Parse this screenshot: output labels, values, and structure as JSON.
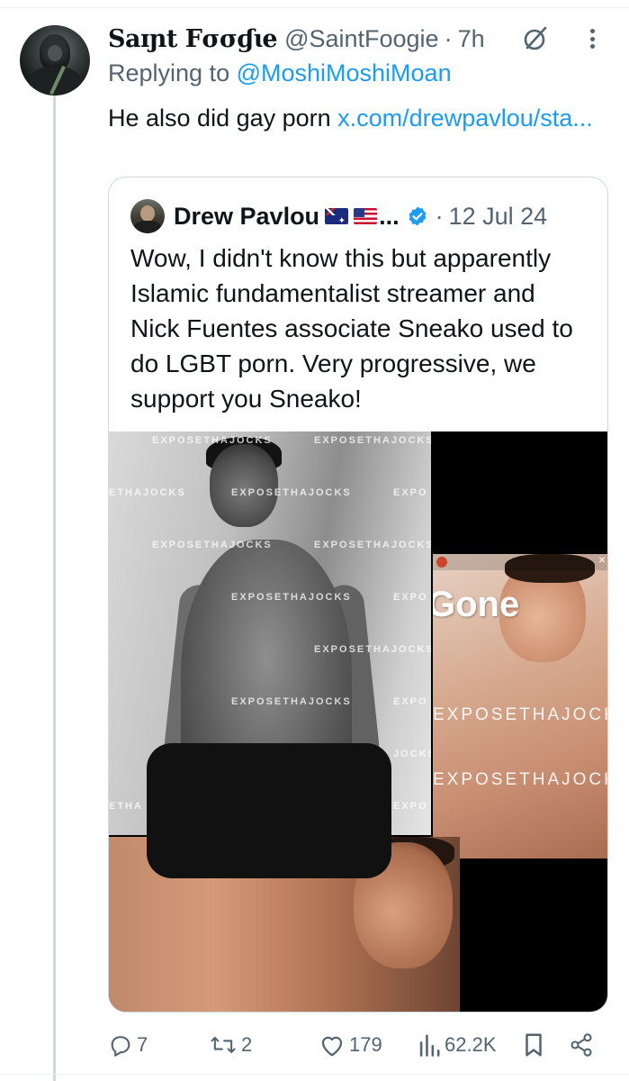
{
  "tweet": {
    "display_name": "Saɪɲt Fσσɠɩe",
    "handle": "@SaintFoogie",
    "separator": "·",
    "time": "7h",
    "replying_prefix": "Replying to ",
    "replying_to": "@MoshiMoshiMoan",
    "text": "He also did gay porn ",
    "link": "x.com/drewpavlou/sta..."
  },
  "quote": {
    "display_name": "Drew Pavlou",
    "ellipsis": "...",
    "separator": "·",
    "date": "12 Jul 24",
    "text": "Wow, I didn't know this but apparently Islamic fundamentalist streamer and Nick Fuentes associate Sneako used to do LGBT porn.  Very progressive, we support you Sneako!",
    "media": {
      "watermark": "EXPOSETHAJOCKS",
      "watermark_partial_1": "ETHAJOCKS",
      "watermark_partial_2": "EXPO",
      "watermark_partial_3": "JOCKS",
      "watermark_partial_4": "ETHA",
      "story_watermark": "EXPOSETHAJOCK",
      "story_caption": "Gone"
    }
  },
  "actions": {
    "replies": "7",
    "reposts": "2",
    "likes": "179",
    "views": "62.2K"
  },
  "colors": {
    "accent": "#1d9bf0",
    "secondary_text": "#536471",
    "primary_text": "#0f1419",
    "border": "#cfd9de"
  }
}
